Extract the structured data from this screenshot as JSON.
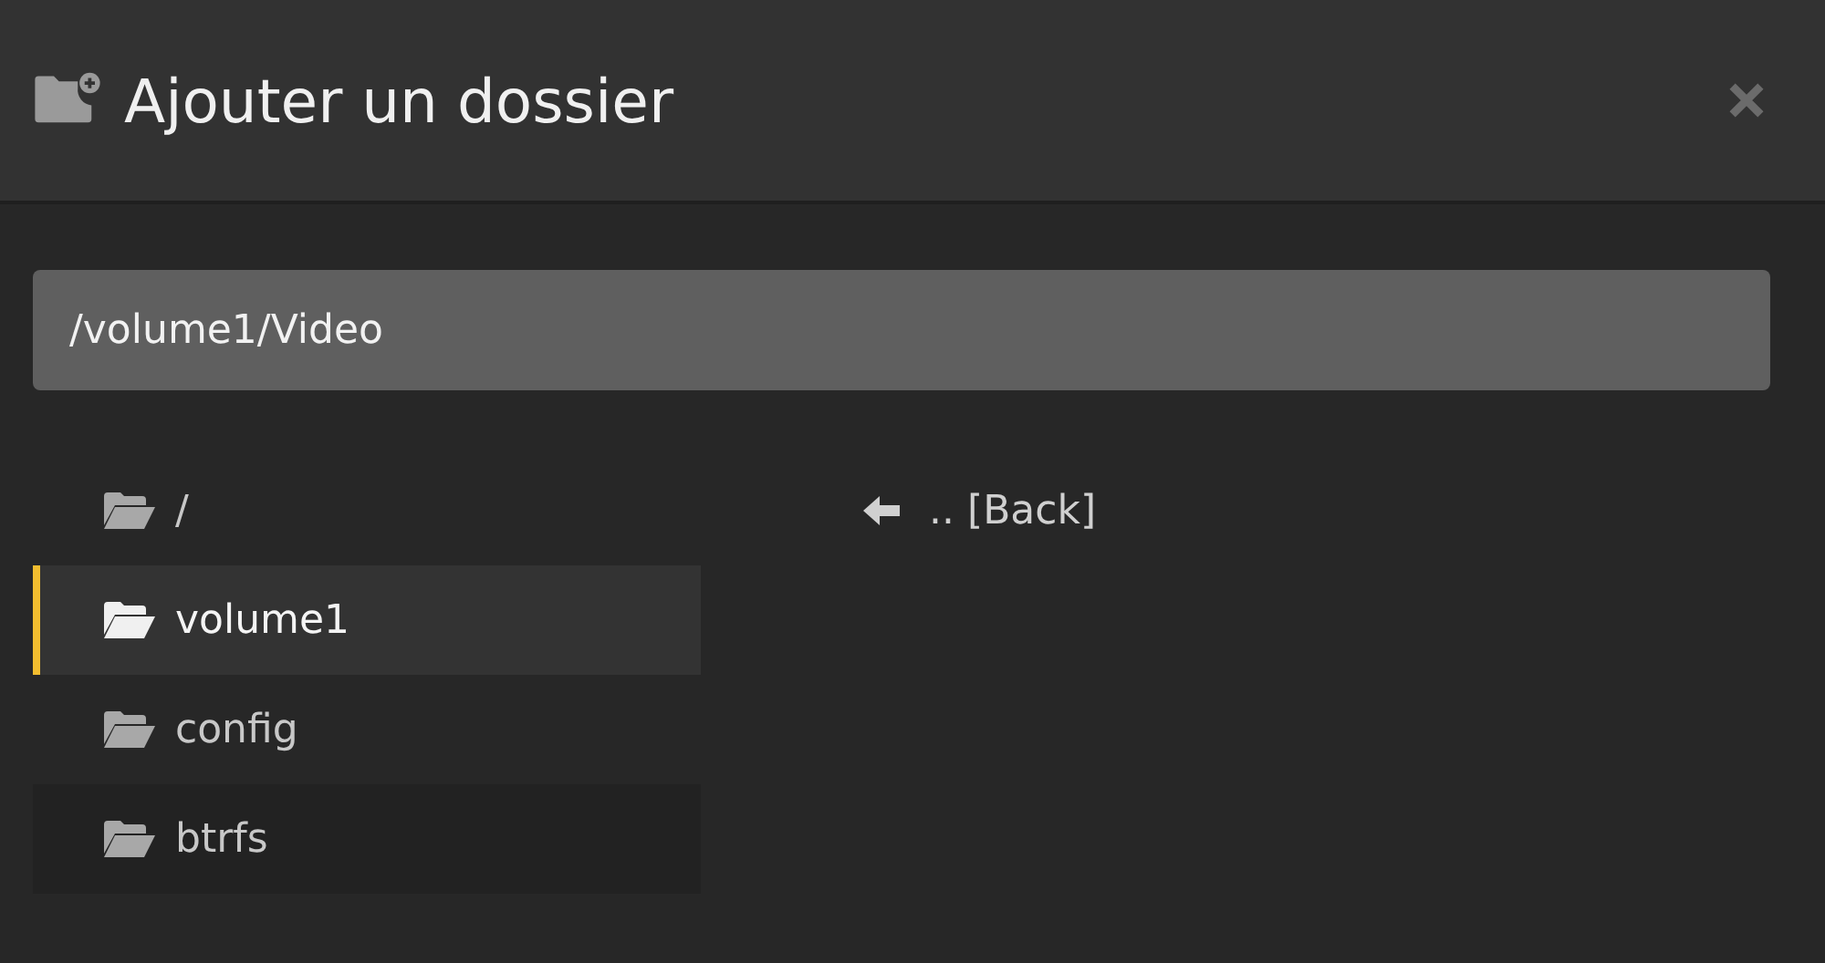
{
  "dialog": {
    "title": "Ajouter un dossier"
  },
  "path_field": {
    "value": "/volume1/Video"
  },
  "folders": [
    {
      "name": "/",
      "selected": false
    },
    {
      "name": "volume1",
      "selected": true
    },
    {
      "name": "config",
      "selected": false
    },
    {
      "name": "btrfs",
      "selected": false
    }
  ],
  "back_link": {
    "label": ".. [Back]"
  }
}
